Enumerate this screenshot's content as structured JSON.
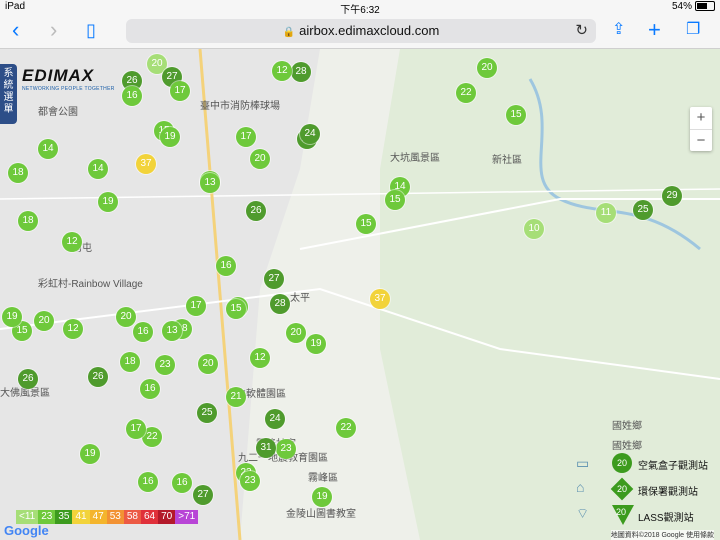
{
  "status_bar": {
    "device": "iPad",
    "time": "下午6:32",
    "battery": "54%"
  },
  "browser": {
    "url": "airbox.edimaxcloud.com"
  },
  "map": {
    "sidebar_tab": "系統選單",
    "logo_text": "EDIMAX",
    "logo_tagline": "NETWORKING PEOPLE TOGETHER",
    "zoom_in": "+",
    "zoom_out": "−",
    "places": [
      "都會公園",
      "臺中市消防棒球場",
      "大坑風景區",
      "新社區",
      "南屯",
      "彩虹村-Rainbow Village",
      "太平",
      "台中軟體園區",
      "大佛風景區",
      "霧峰區",
      "九二一地震教育園區",
      "金陵山圖書教室",
      "國姓鄉",
      "霧峰林家"
    ],
    "markers": [
      {
        "v": "26",
        "c": "dg"
      },
      {
        "v": "20",
        "c": "lg"
      },
      {
        "v": "27",
        "c": "dg"
      },
      {
        "v": "28",
        "c": "dg"
      },
      {
        "v": "20",
        "c": "g"
      },
      {
        "v": "17",
        "c": "g"
      },
      {
        "v": "12",
        "c": "g"
      },
      {
        "v": "16",
        "c": "g"
      },
      {
        "v": "22",
        "c": "g"
      },
      {
        "v": "15",
        "c": "g"
      },
      {
        "v": "24",
        "c": "dg"
      },
      {
        "v": "17",
        "c": "g"
      },
      {
        "v": "19",
        "c": "g"
      },
      {
        "v": "20",
        "c": "g"
      },
      {
        "v": "37",
        "c": "y"
      },
      {
        "v": "15",
        "c": "g"
      },
      {
        "v": "14",
        "c": "g"
      },
      {
        "v": "16",
        "c": "g"
      },
      {
        "v": "15",
        "c": "g"
      },
      {
        "v": "29",
        "c": "dg"
      },
      {
        "v": "11",
        "c": "lg"
      },
      {
        "v": "25",
        "c": "dg"
      },
      {
        "v": "10",
        "c": "lg"
      },
      {
        "v": "14",
        "c": "g"
      },
      {
        "v": "13",
        "c": "g"
      },
      {
        "v": "19",
        "c": "g"
      },
      {
        "v": "18",
        "c": "g"
      },
      {
        "v": "12",
        "c": "g"
      },
      {
        "v": "16",
        "c": "g"
      },
      {
        "v": "26",
        "c": "dg"
      },
      {
        "v": "15",
        "c": "g"
      },
      {
        "v": "20",
        "c": "g"
      },
      {
        "v": "37",
        "c": "y"
      },
      {
        "v": "19",
        "c": "g"
      },
      {
        "v": "16",
        "c": "g"
      },
      {
        "v": "17",
        "c": "g"
      },
      {
        "v": "15",
        "c": "g"
      },
      {
        "v": "20",
        "c": "g"
      },
      {
        "v": "28",
        "c": "dg"
      },
      {
        "v": "18",
        "c": "g"
      },
      {
        "v": "16",
        "c": "g"
      },
      {
        "v": "23",
        "c": "g"
      },
      {
        "v": "26",
        "c": "dg"
      },
      {
        "v": "12",
        "c": "g"
      },
      {
        "v": "22",
        "c": "g"
      },
      {
        "v": "25",
        "c": "dg"
      },
      {
        "v": "21",
        "c": "g"
      },
      {
        "v": "23",
        "c": "g"
      },
      {
        "v": "24",
        "c": "dg"
      },
      {
        "v": "31",
        "c": "dg"
      },
      {
        "v": "22",
        "c": "g"
      },
      {
        "v": "19",
        "c": "g"
      },
      {
        "v": "17",
        "c": "g"
      },
      {
        "v": "22",
        "c": "g"
      },
      {
        "v": "27",
        "c": "dg"
      },
      {
        "v": "16",
        "c": "g"
      },
      {
        "v": "15",
        "c": "g"
      },
      {
        "v": "19",
        "c": "g"
      },
      {
        "v": "14",
        "c": "g"
      },
      {
        "v": "18",
        "c": "g"
      },
      {
        "v": "20",
        "c": "g"
      },
      {
        "v": "13",
        "c": "g"
      },
      {
        "v": "27",
        "c": "dg"
      },
      {
        "v": "15",
        "c": "g"
      },
      {
        "v": "19",
        "c": "g"
      },
      {
        "v": "20",
        "c": "g"
      },
      {
        "v": "23",
        "c": "g"
      },
      {
        "v": "16",
        "c": "g"
      },
      {
        "v": "18",
        "c": "g"
      },
      {
        "v": "26",
        "c": "dg"
      },
      {
        "v": "24",
        "c": "dg"
      },
      {
        "v": "12",
        "c": "g"
      }
    ],
    "scale_legend": [
      {
        "label": "<11",
        "color": "#a6de77"
      },
      {
        "label": "23",
        "color": "#6ec93b"
      },
      {
        "label": "35",
        "color": "#3c9b1e"
      },
      {
        "label": "41",
        "color": "#f2d33a"
      },
      {
        "label": "47",
        "color": "#f4b52c"
      },
      {
        "label": "53",
        "color": "#f29233"
      },
      {
        "label": "58",
        "color": "#ec5a44"
      },
      {
        "label": "64",
        "color": "#e0303a"
      },
      {
        "label": "70",
        "color": "#b3192a"
      },
      {
        "label": ">71",
        "color": "#b845d6"
      }
    ],
    "station_legend": [
      {
        "label": "空氣盒子觀測站",
        "value": "20"
      },
      {
        "label": "環保署觀測站",
        "value": "20"
      },
      {
        "label": "LASS觀測站",
        "value": "20"
      }
    ],
    "station_legend_region": "國姓鄉",
    "google": "Google",
    "copyright": "地圖資料©2018 Google 使用條款"
  }
}
